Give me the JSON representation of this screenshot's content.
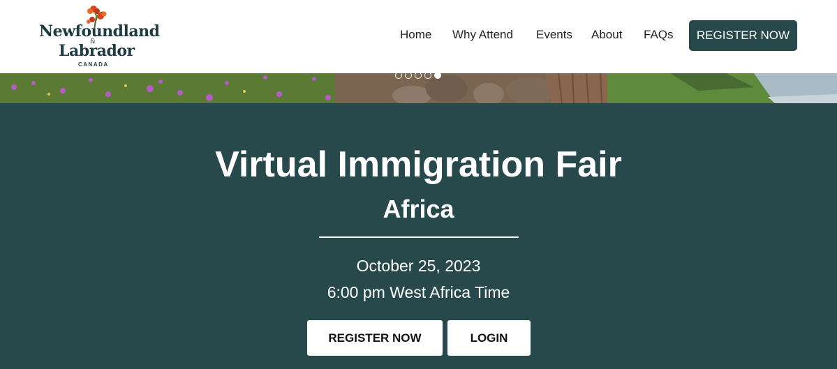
{
  "header": {
    "logo": {
      "line1": "Newfoundland",
      "amp": "&",
      "line2": "Labrador",
      "line3": "CANADA",
      "icon": "pitcher-plant-flower-icon"
    },
    "nav": [
      {
        "label": "Home"
      },
      {
        "label": "Why Attend"
      },
      {
        "label": "Events"
      },
      {
        "label": "About"
      },
      {
        "label": "FAQs"
      }
    ],
    "register_label": "REGISTER NOW"
  },
  "carousel": {
    "slide_count": 5,
    "active_index": 4
  },
  "hero": {
    "title": "Virtual Immigration Fair",
    "subtitle": "Africa",
    "date": "October 25, 2023",
    "time": "6:00 pm West Africa Time",
    "register_label": "REGISTER NOW",
    "login_label": "LOGIN"
  },
  "colors": {
    "brand_dark_teal": "#27494b",
    "white": "#ffffff"
  }
}
